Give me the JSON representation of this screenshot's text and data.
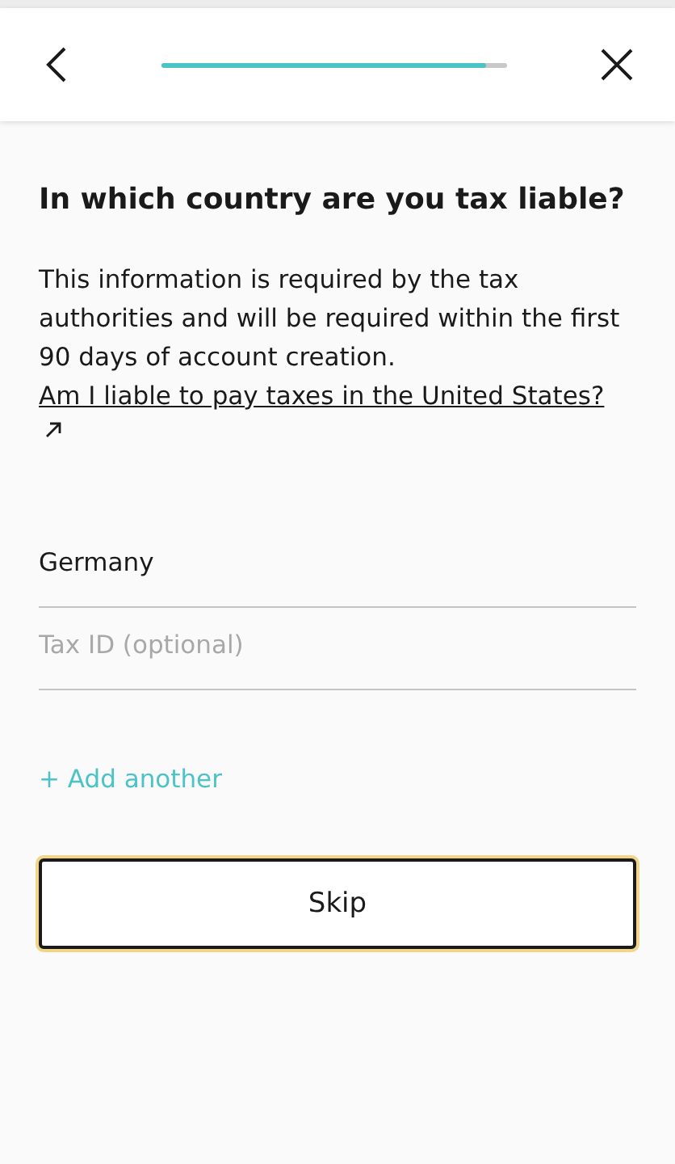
{
  "header": {
    "progress": {
      "level": 0.94
    }
  },
  "title": "In which country are you tax liable?",
  "description": "This information is required by the tax authorities and will be required within the first 90 days of account creation.",
  "help_link": "Am I liable to pay taxes in the United States?",
  "fields": [
    {
      "kind": "value",
      "value": "Germany"
    },
    {
      "kind": "placeholder",
      "placeholder": "Tax ID (optional)"
    }
  ],
  "add_link": "+ Add another",
  "skip_button": "Skip"
}
